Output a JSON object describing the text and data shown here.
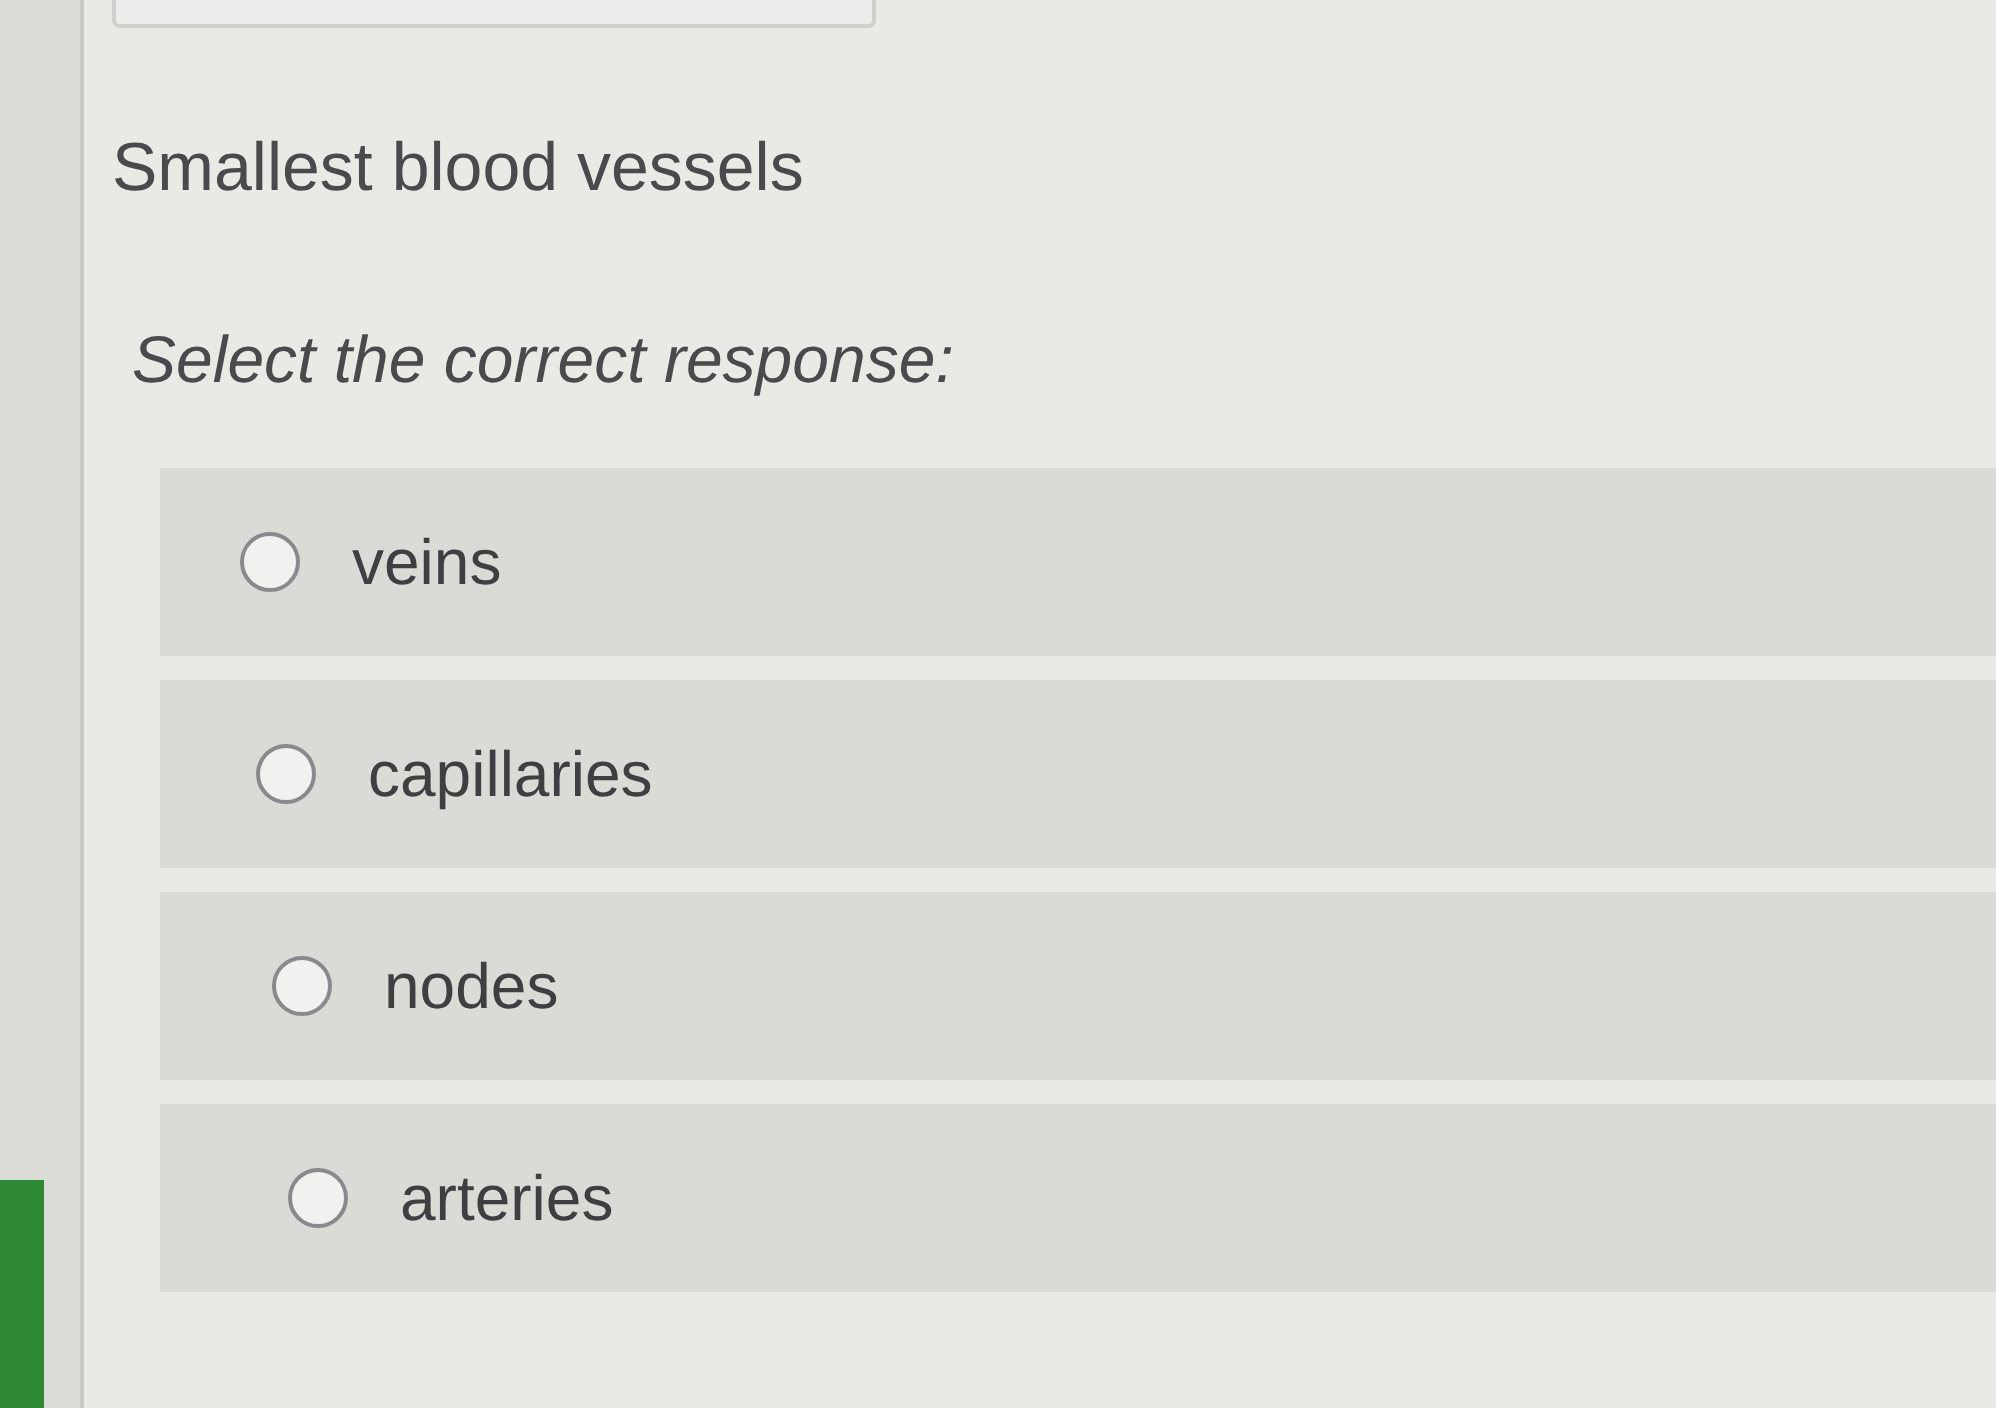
{
  "question": {
    "title": "Smallest blood vessels",
    "prompt": "Select the correct response:"
  },
  "options": [
    {
      "label": "veins",
      "selected": false
    },
    {
      "label": "capillaries",
      "selected": false
    },
    {
      "label": "nodes",
      "selected": false
    },
    {
      "label": "arteries",
      "selected": false
    }
  ]
}
